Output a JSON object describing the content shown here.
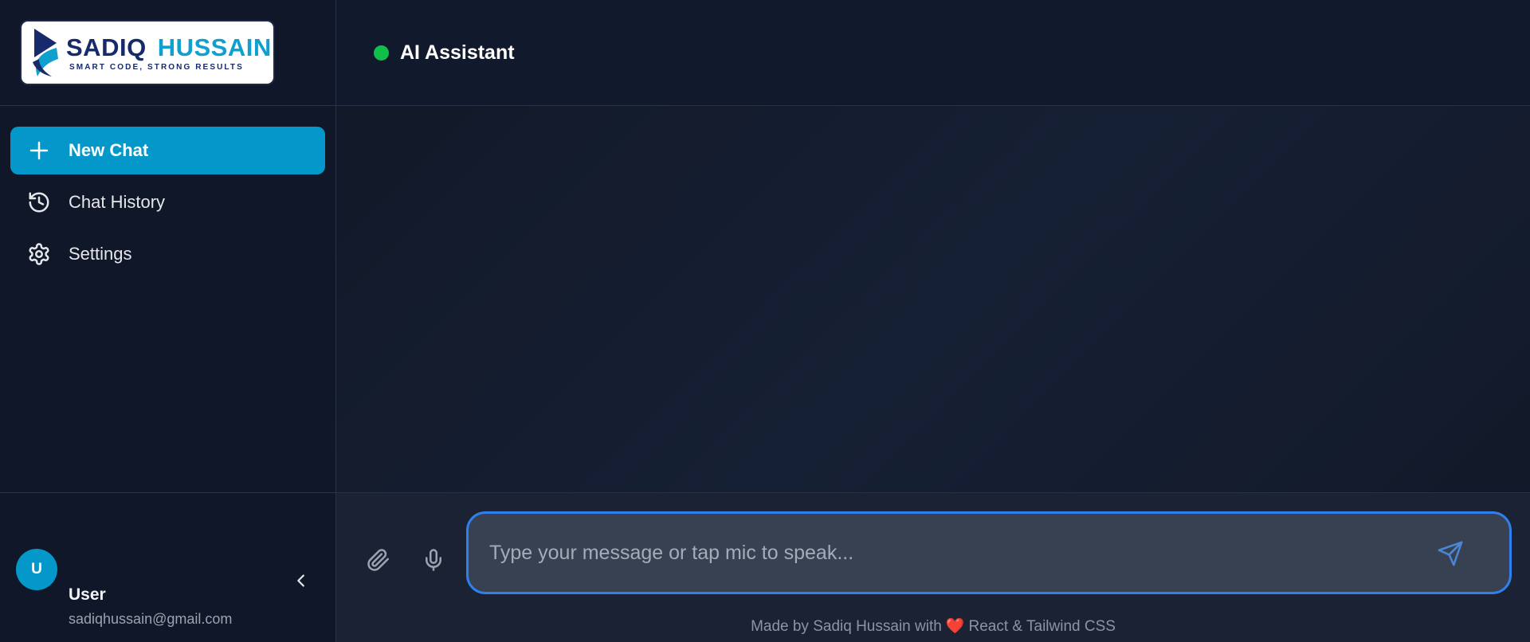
{
  "brand": {
    "name_first": "SADIQ",
    "name_second": "HUSSAIN",
    "tagline": "SMART CODE, STRONG RESULTS",
    "colors": {
      "navy": "#172a6b",
      "cyan": "#0fa0d0"
    }
  },
  "sidebar": {
    "items": [
      {
        "label": "New Chat",
        "icon": "plus-icon",
        "active": true
      },
      {
        "label": "Chat History",
        "icon": "history-icon",
        "active": false
      },
      {
        "label": "Settings",
        "icon": "gear-icon",
        "active": false
      }
    ],
    "user": {
      "initial": "U",
      "name": "User",
      "email": "sadiqhussain@gmail.com"
    }
  },
  "header": {
    "title": "AI Assistant",
    "status_color": "#10c04a"
  },
  "composer": {
    "placeholder": "Type your message or tap mic to speak...",
    "value": "",
    "accent": "#2f80ed"
  },
  "footer": {
    "made_by": "Made by Sadiq Hussain with",
    "heart": "❤️",
    "tech": "React & Tailwind CSS"
  },
  "colors": {
    "primary": "#0398c9",
    "sidebar_bg": "#101729",
    "main_bg": "#111827"
  }
}
